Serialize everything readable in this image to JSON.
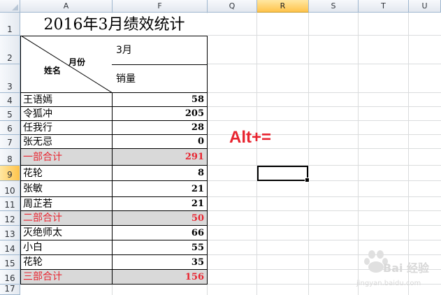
{
  "columns": [
    "A",
    "F",
    "Q",
    "R",
    "S",
    "T",
    "U"
  ],
  "selected_column": "R",
  "rows": [
    "1",
    "2",
    "3",
    "4",
    "5",
    "6",
    "7",
    "8",
    "9",
    "10",
    "11",
    "12",
    "13",
    "14",
    "15",
    "16",
    "17"
  ],
  "selected_row": "9",
  "title": "2016年3月绩效统计",
  "header": {
    "diagonal_top": "月份",
    "diagonal_bottom": "姓名",
    "month": "3月",
    "sales_label": "销量"
  },
  "data_rows": [
    {
      "name": "王语嫣",
      "value": "58",
      "subtotal": false
    },
    {
      "name": "令狐冲",
      "value": "205",
      "subtotal": false
    },
    {
      "name": "任我行",
      "value": "28",
      "subtotal": false
    },
    {
      "name": "张无忌",
      "value": "0",
      "subtotal": false
    },
    {
      "name": "一部合计",
      "value": "291",
      "subtotal": true
    },
    {
      "name": "花轮",
      "value": "8",
      "subtotal": false
    },
    {
      "name": "张敏",
      "value": "21",
      "subtotal": false
    },
    {
      "name": "周芷若",
      "value": "21",
      "subtotal": false
    },
    {
      "name": "二部合计",
      "value": "50",
      "subtotal": true
    },
    {
      "name": "灭绝师太",
      "value": "66",
      "subtotal": false
    },
    {
      "name": "小白",
      "value": "55",
      "subtotal": false
    },
    {
      "name": "花轮",
      "value": "35",
      "subtotal": false
    },
    {
      "name": "三部合计",
      "value": "156",
      "subtotal": true
    }
  ],
  "overlay_text": "Alt+=",
  "watermark": {
    "brand": "Bai 经验",
    "url": "jingyan.baidu.com"
  },
  "colors": {
    "subtotal_text": "#e8242f",
    "subtotal_fill": "#d9d9d9",
    "selected_header": "#ffc34a",
    "grid": "#dadcdd"
  }
}
